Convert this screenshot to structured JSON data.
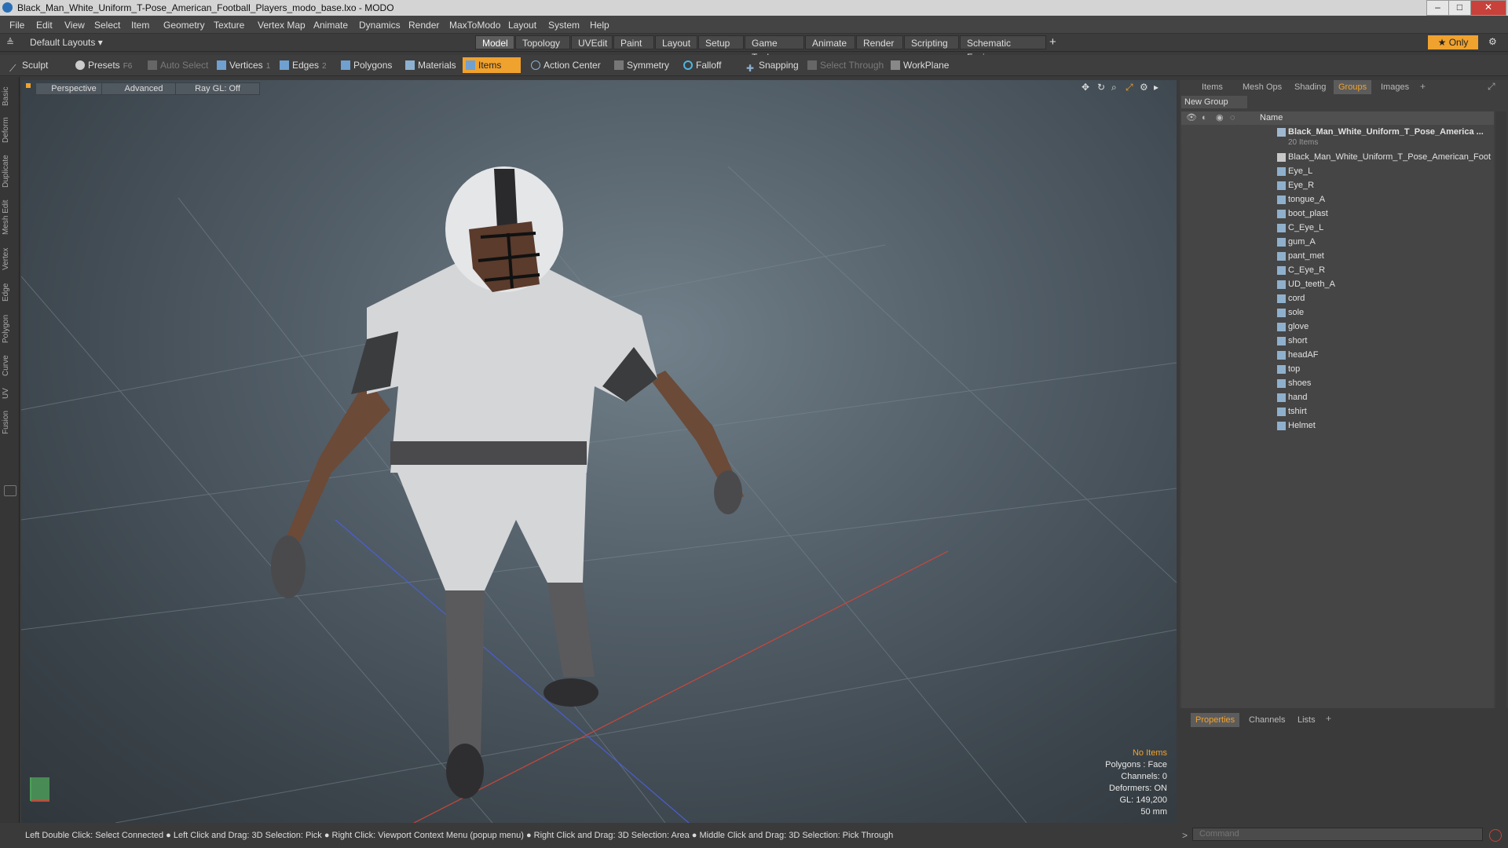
{
  "window": {
    "title": "Black_Man_White_Uniform_T-Pose_American_Football_Players_modo_base.lxo - MODO"
  },
  "menu": [
    "File",
    "Edit",
    "View",
    "Select",
    "Item",
    "Geometry",
    "Texture",
    "Vertex Map",
    "Animate",
    "Dynamics",
    "Render",
    "MaxToModo",
    "Layout",
    "System",
    "Help"
  ],
  "layout_selector": "Default Layouts ▾",
  "tabs": [
    "Model",
    "Topology",
    "UVEdit",
    "Paint",
    "Layout",
    "Setup",
    "Game Tools",
    "Animate",
    "Render",
    "Scripting",
    "Schematic Fusion"
  ],
  "tabs_add": "+",
  "only_button": "Only",
  "toolbar": {
    "sculpt": "Sculpt",
    "presets": "Presets",
    "presets_key": "F6",
    "auto_select": "Auto Select",
    "vertices": "Vertices",
    "vertices_key": "1",
    "edges": "Edges",
    "edges_key": "2",
    "polygons": "Polygons",
    "materials": "Materials",
    "items": "Items",
    "action_center": "Action Center",
    "symmetry": "Symmetry",
    "falloff": "Falloff",
    "snapping": "Snapping",
    "select_through": "Select Through",
    "workplane": "WorkPlane"
  },
  "left_tabs": [
    "Basic",
    "Deform",
    "Duplicate",
    "Mesh Edit",
    "Vertex",
    "Edge",
    "Polygon",
    "Curve",
    "UV",
    "Fusion"
  ],
  "viewport": {
    "view": "Perspective",
    "style": "Advanced",
    "raygl": "Ray GL: Off",
    "info": {
      "items": "No Items",
      "polygons": "Polygons : Face",
      "channels": "Channels: 0",
      "deformers": "Deformers: ON",
      "gl": "GL: 149,200",
      "lens": "50 mm"
    }
  },
  "status": "Left Double Click: Select Connected ● Left Click and Drag: 3D Selection: Pick ● Right Click: Viewport Context Menu (popup menu) ● Right Click and Drag: 3D Selection: Area ● Middle Click and Drag: 3D Selection: Pick Through",
  "panel": {
    "tabs": [
      "Items",
      "Mesh Ops",
      "Shading",
      "Groups",
      "Images"
    ],
    "active_tab": "Groups",
    "new_group": "New Group",
    "name_header": "Name",
    "group_name": "Black_Man_White_Uniform_T_Pose_America ...",
    "group_count": "20 Items",
    "items": [
      "Black_Man_White_Uniform_T_Pose_American_Foot ...",
      "Eye_L",
      "Eye_R",
      "tongue_A",
      "boot_plast",
      "C_Eye_L",
      "gum_A",
      "pant_met",
      "C_Eye_R",
      "UD_teeth_A",
      "cord",
      "sole",
      "glove",
      "short",
      "headAF",
      "top",
      "shoes",
      "hand",
      "tshirt",
      "Helmet"
    ]
  },
  "bottom_panel": {
    "tabs": [
      "Properties",
      "Channels",
      "Lists"
    ],
    "active_tab": "Properties"
  },
  "command": {
    "placeholder": "Command"
  },
  "colors": {
    "accent": "#f0a22e"
  }
}
